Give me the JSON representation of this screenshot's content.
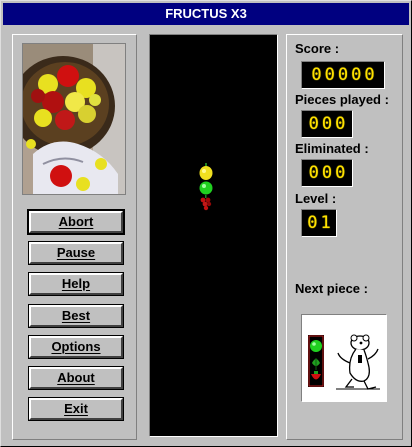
{
  "window": {
    "title": "FRUCTUS X3"
  },
  "buttons": {
    "abort": "Abort",
    "pause": "Pause",
    "help": "Help",
    "best": "Best",
    "options": "Options",
    "about": "About",
    "exit": "Exit"
  },
  "stats": {
    "score_label": "Score :",
    "score_value": "00000",
    "pieces_label": "Pieces played :",
    "pieces_value": "000",
    "eliminated_label": "Eliminated :",
    "eliminated_value": "000",
    "level_label": "Level :",
    "level_value": "01",
    "next_label": "Next piece :"
  },
  "falling_piece": [
    "lemon",
    "lime",
    "grapes"
  ],
  "next_piece": [
    "lime",
    "leaves",
    "strawberry"
  ],
  "colors": {
    "title_bar": "#000080",
    "face": "#c0c0c0",
    "counter_digits": "#ffe000",
    "playfield": "#000000"
  },
  "icons": {
    "picture": "fruit-bowl-picture",
    "mascot": "mascot-icon"
  }
}
